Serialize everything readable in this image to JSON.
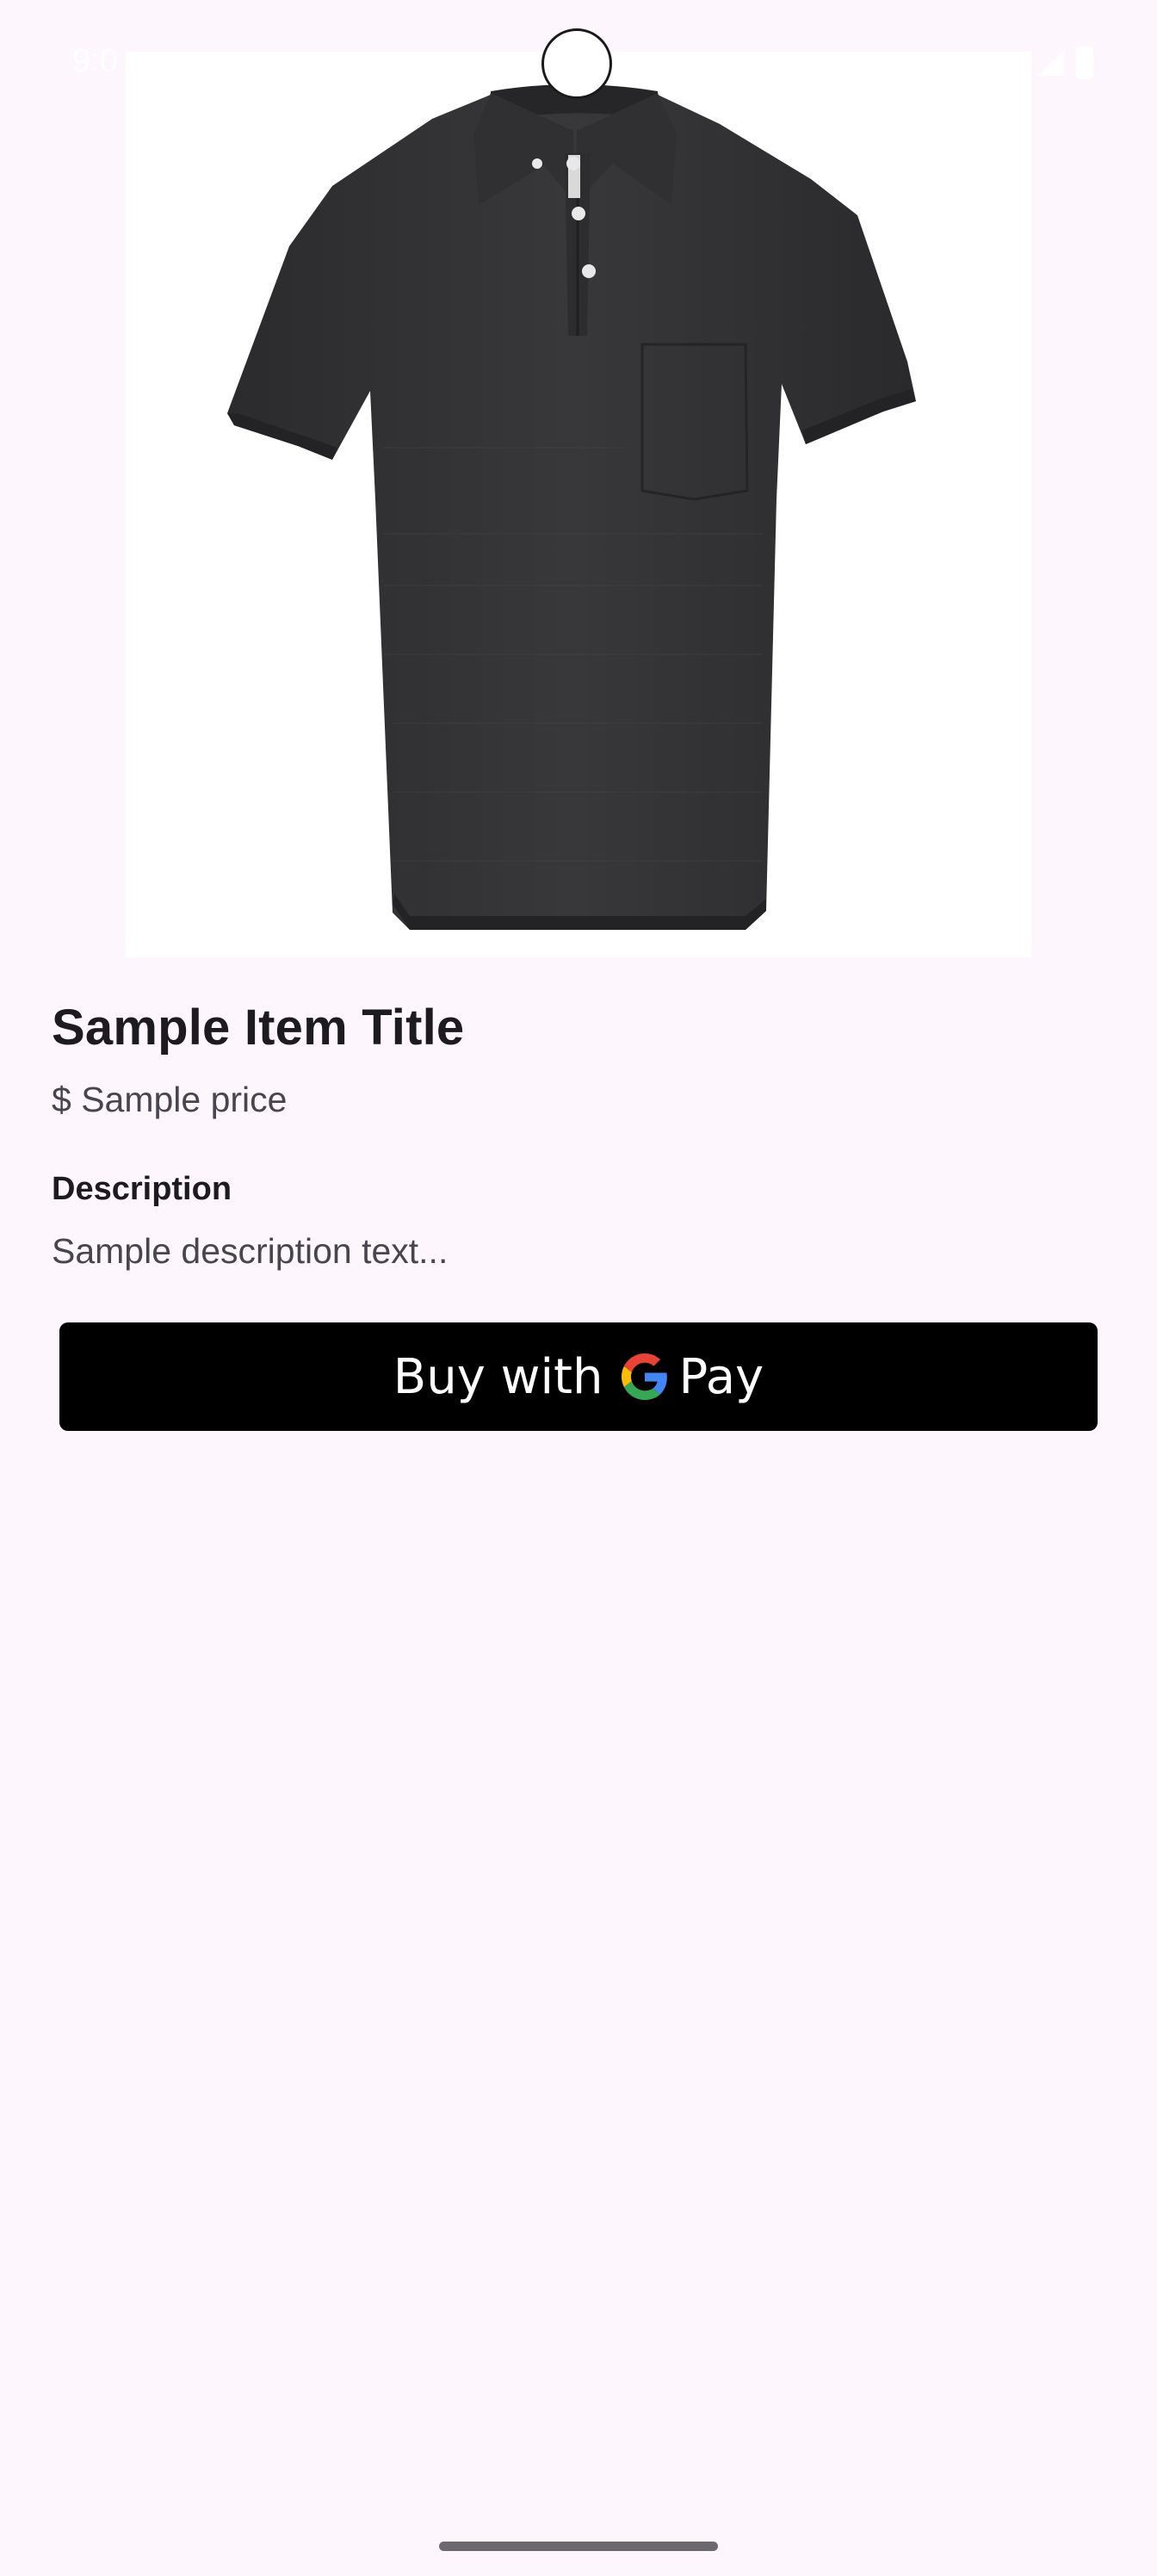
{
  "status_bar": {
    "time": "9:0"
  },
  "product": {
    "image_icon": "polo-shirt-image",
    "title": "Sample Item Title",
    "price": "$ Sample price",
    "description_heading": "Description",
    "description_text": "Sample description text..."
  },
  "gpay_button": {
    "label": "Buy with",
    "pay_label": "Pay",
    "icon": "google-g-icon",
    "background": "#000000"
  },
  "colors": {
    "background": "#fdf7fd",
    "title": "#1d1b20",
    "secondary_text": "#49454f"
  }
}
